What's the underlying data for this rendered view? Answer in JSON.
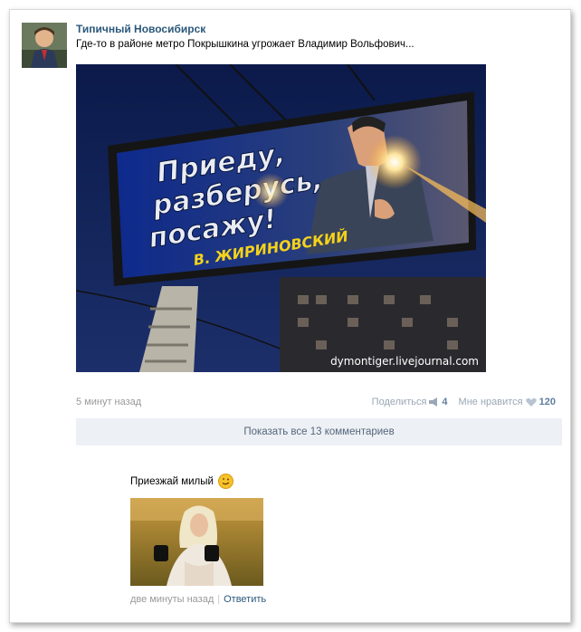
{
  "post": {
    "author": "Типичный Новосибирск",
    "text": "Где-то в районе метро Покрышкина угрожает Владимир Вольфович...",
    "image": {
      "billboard_lines": [
        "Приеду,",
        "разберусь,",
        "посажу!"
      ],
      "billboard_signature": "В. ЖИРИНОВСКИЙ",
      "watermark": "dymontiger.livejournal.com"
    },
    "time": "5 минут назад",
    "share_label": "Поделиться",
    "share_count": "4",
    "like_label": "Мне нравится",
    "like_count": "120",
    "show_all_comments": "Показать все 13 комментариев"
  },
  "comment": {
    "text": "Приезжай милый",
    "time": "две минуты назад",
    "reply_label": "Ответить"
  },
  "colors": {
    "link": "#2b587a",
    "muted": "#999999",
    "panel": "#edf0f4"
  }
}
